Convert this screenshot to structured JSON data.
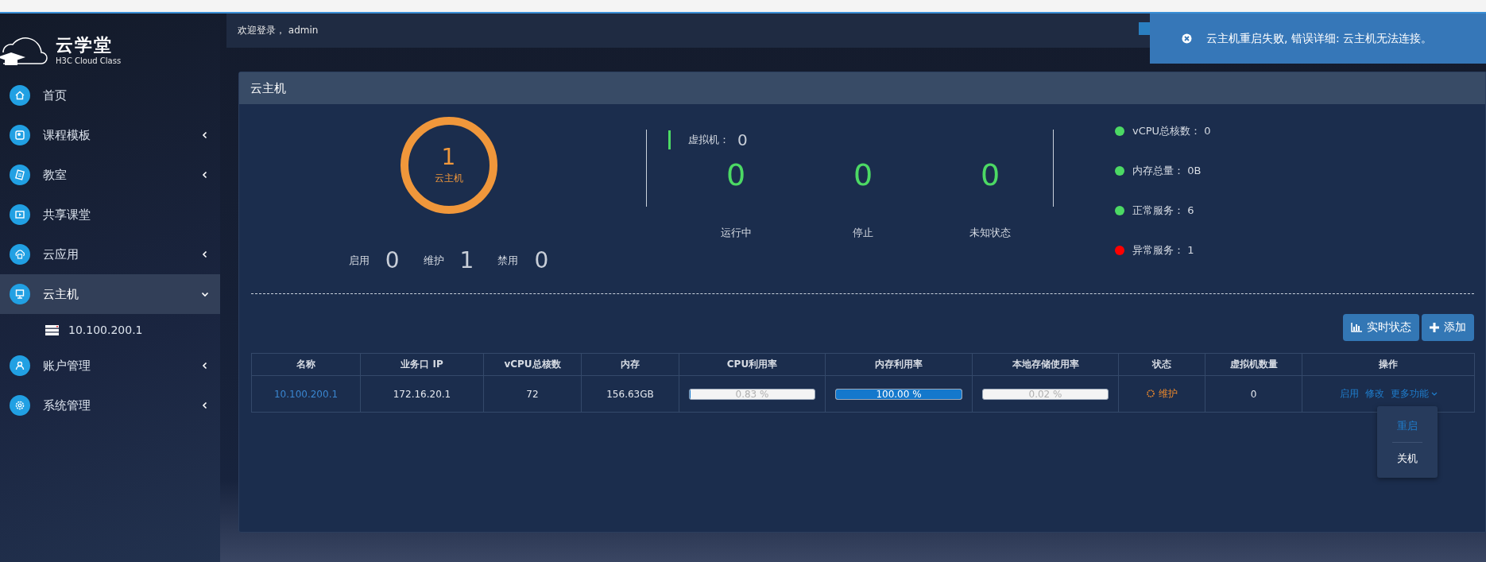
{
  "top_bar": {
    "greeting": "欢迎登录， admin"
  },
  "toast": {
    "message": "云主机重启失败, 错误详细: 云主机无法连接。"
  },
  "logo": {
    "name": "云学堂",
    "subtitle": "H3C Cloud Class"
  },
  "sidebar": {
    "items": [
      {
        "label": "首页",
        "kind": "link",
        "selected": false
      },
      {
        "label": "课程模板",
        "kind": "group",
        "selected": false,
        "expanded": false
      },
      {
        "label": "教室",
        "kind": "group",
        "selected": false,
        "expanded": false
      },
      {
        "label": "共享课堂",
        "kind": "link",
        "selected": false
      },
      {
        "label": "云应用",
        "kind": "group",
        "selected": false,
        "expanded": false
      },
      {
        "label": "云主机",
        "kind": "group",
        "selected": true,
        "expanded": true,
        "children": [
          {
            "label": "10.100.200.1"
          }
        ]
      },
      {
        "label": "账户管理",
        "kind": "group",
        "selected": false,
        "expanded": false
      },
      {
        "label": "系统管理",
        "kind": "group",
        "selected": false,
        "expanded": false
      }
    ]
  },
  "panel": {
    "title": "云主机",
    "ring": {
      "value": "1",
      "label": "云主机"
    },
    "host_counts": [
      {
        "label": "启用",
        "value": "0"
      },
      {
        "label": "维护",
        "value": "1"
      },
      {
        "label": "禁用",
        "value": "0"
      }
    ],
    "vm": {
      "label": "虚拟机：",
      "value": "0"
    },
    "vm_states": [
      {
        "value": "0",
        "label": "运行中"
      },
      {
        "value": "0",
        "label": "停止"
      },
      {
        "value": "0",
        "label": "未知状态"
      }
    ],
    "summary": [
      {
        "label": "vCPU总核数：",
        "value": "0",
        "color": "#4cd964"
      },
      {
        "label": "内存总量：",
        "value": "0B",
        "color": "#4cd964"
      },
      {
        "label": "正常服务：",
        "value": "6",
        "color": "#4cd964"
      },
      {
        "label": "异常服务：",
        "value": "1",
        "color": "#ff0000"
      }
    ],
    "buttons": [
      {
        "label": "实时状态",
        "kind": "chart"
      },
      {
        "label": "添加",
        "kind": "add"
      }
    ],
    "table": {
      "columns": [
        "名称",
        "业务口 IP",
        "vCPU总核数",
        "内存",
        "CPU利用率",
        "内存利用率",
        "本地存储使用率",
        "状态",
        "虚拟机数量",
        "操作"
      ],
      "rows": [
        {
          "name": "10.100.200.1",
          "ip": "172.16.20.1",
          "vcpu": "72",
          "memory": "156.63GB",
          "cpu": {
            "level": 0.0083,
            "text": "0.83 %"
          },
          "mem": {
            "level": 1,
            "text": "100.00 %"
          },
          "disk": {
            "level": 0.0002,
            "text": "0.02 %"
          },
          "status": "维护",
          "vm_count": "0",
          "actions": [
            "启用",
            "修改",
            "更多功能"
          ]
        }
      ]
    },
    "dropdown": {
      "items": [
        {
          "label": "重启",
          "selected": true
        },
        {
          "label": "关机",
          "selected": false
        }
      ]
    }
  }
}
